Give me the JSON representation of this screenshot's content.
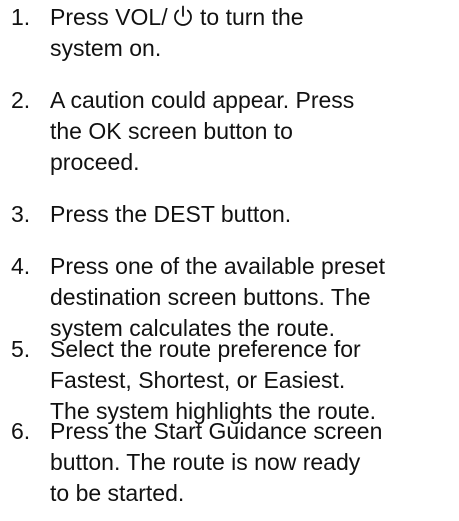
{
  "steps": [
    {
      "number": "1.",
      "lines": [
        "Press VOL/",
        "to turn the",
        "system on."
      ],
      "icon": "power-icon"
    },
    {
      "number": "2.",
      "lines": [
        "A caution could appear. Press",
        "the OK screen button to",
        "proceed."
      ]
    },
    {
      "number": "3.",
      "lines": [
        "Press the DEST button."
      ]
    },
    {
      "number": "4.",
      "lines": [
        "Press one of the available preset",
        "destination screen buttons. The",
        "system calculates the route."
      ]
    },
    {
      "number": "5.",
      "lines": [
        "Select the route preference for",
        "Fastest, Shortest, or Easiest.",
        "The system highlights the route."
      ]
    },
    {
      "number": "6.",
      "lines": [
        "Press the Start Guidance screen",
        "button. The route is now ready",
        "to be started."
      ]
    }
  ]
}
